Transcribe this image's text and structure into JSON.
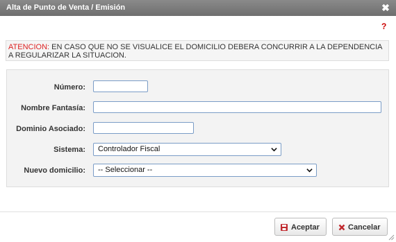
{
  "dialog": {
    "title": "Alta de Punto de Venta / Emisión",
    "close_symbol": "✖",
    "help_symbol": "?"
  },
  "warning": {
    "label": "ATENCION:",
    "text": " EN CASO QUE NO SE VISUALICE EL DOMICILIO DEBERA CONCURRIR A LA DEPENDENCIA A REGULARIZAR LA SITUACION."
  },
  "form": {
    "numero": {
      "label": "Número:",
      "value": ""
    },
    "nombre_fantasia": {
      "label": "Nombre Fantasía:",
      "value": ""
    },
    "dominio_asociado": {
      "label": "Dominio Asociado:",
      "value": ""
    },
    "sistema": {
      "label": "Sistema:",
      "selected": "Controlador Fiscal"
    },
    "nuevo_domicilio": {
      "label": "Nuevo domicilio:",
      "selected": "-- Seleccionar --"
    }
  },
  "buttons": {
    "accept": {
      "label": "Aceptar",
      "icon": "save-icon"
    },
    "cancel": {
      "label": "Cancelar",
      "icon": "cancel-x-icon"
    }
  },
  "colors": {
    "title_bar": "#777777",
    "warning_accent": "#dd2222",
    "input_border": "#7a9cc6"
  }
}
